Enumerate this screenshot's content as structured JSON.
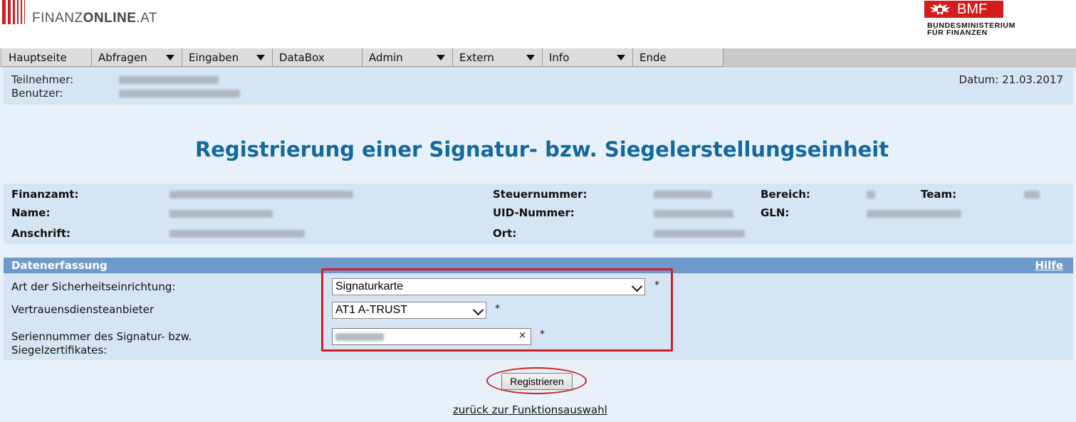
{
  "header": {
    "logo_prefix": "FINANZ",
    "logo_bold": "ONLINE",
    "logo_suffix": ".AT",
    "bmf_label": "BMF",
    "bmf_sub_line1": "BUNDESMINISTERIUM",
    "bmf_sub_line2": "FÜR FINANZEN",
    "brand_color": "#d41c1c"
  },
  "menu": [
    {
      "label": "Hauptseite",
      "dropdown": false
    },
    {
      "label": "Abfragen",
      "dropdown": true
    },
    {
      "label": "Eingaben",
      "dropdown": true
    },
    {
      "label": "DataBox",
      "dropdown": false
    },
    {
      "label": "Admin",
      "dropdown": true
    },
    {
      "label": "Extern",
      "dropdown": true
    },
    {
      "label": "Info",
      "dropdown": true
    },
    {
      "label": "Ende",
      "dropdown": false
    }
  ],
  "userinfo": {
    "teilnehmer_label": "Teilnehmer:",
    "benutzer_label": "Benutzer:",
    "datum": "Datum: 21.03.2017"
  },
  "page_title": "Registrierung einer Signatur- bzw. Siegelerstellungseinheit",
  "taxpayer": {
    "finanzamt_label": "Finanzamt:",
    "name_label": "Name:",
    "anschrift_label": "Anschrift:",
    "steuernummer_label": "Steuernummer:",
    "uid_label": "UID-Nummer:",
    "ort_label": "Ort:",
    "bereich_label": "Bereich:",
    "gln_label": "GLN:",
    "team_label": "Team:"
  },
  "form": {
    "section_title": "Datenerfassung",
    "help_link": "Hilfe",
    "field1_label": "Art der Sicherheitseinrichtung:",
    "field1_value": "Signaturkarte",
    "field2_label": "Vertrauensdiensteanbieter",
    "field2_value": "AT1 A-TRUST",
    "field3_label_line1": "Seriennummer des Signatur- bzw.",
    "field3_label_line2": "Siegelzertifikates:",
    "field3_clear": "×",
    "required_mark": "*",
    "highlight_color": "#d21f26"
  },
  "actions": {
    "register_label": "Registrieren",
    "back_link": "zurück zur Funktionsauswahl"
  }
}
